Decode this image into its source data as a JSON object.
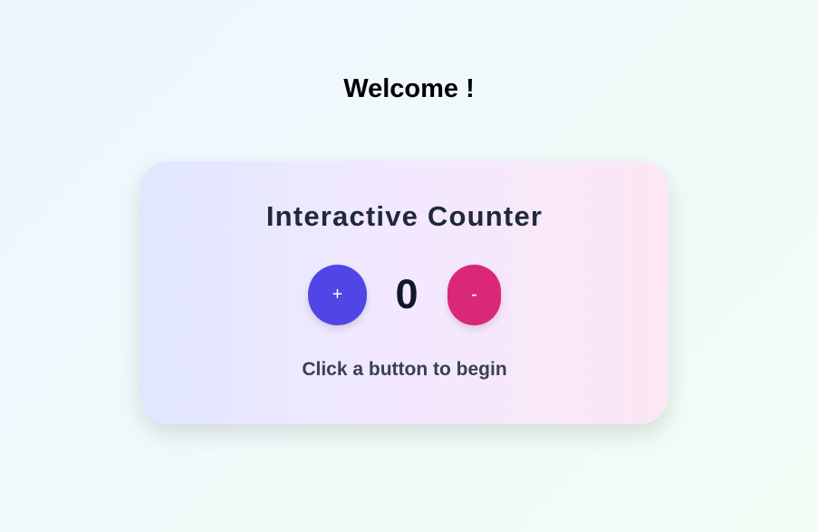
{
  "page": {
    "welcome": "Welcome !"
  },
  "counter": {
    "title": "Interactive Counter",
    "increment_label": "+",
    "decrement_label": "-",
    "value": "0",
    "status": "Click a button to begin"
  },
  "colors": {
    "increment": "#4f46e5",
    "decrement": "#db2777"
  }
}
